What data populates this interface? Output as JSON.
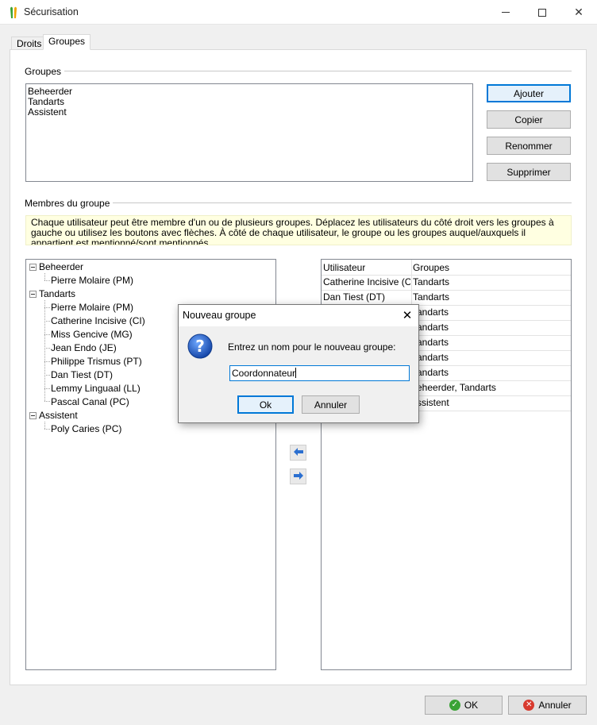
{
  "window": {
    "title": "Sécurisation",
    "icons": {
      "app": "app-logo-icon",
      "minimize": "minimize-icon",
      "maximize": "maximize-icon",
      "close": "close-icon"
    }
  },
  "tabs": [
    {
      "label": "Droits"
    },
    {
      "label": "Groupes"
    }
  ],
  "groups_section": {
    "label": "Groupes",
    "items": [
      "Beheerder",
      "Tandarts",
      "Assistent"
    ],
    "buttons": {
      "add": "Ajouter",
      "copy": "Copier",
      "rename": "Renommer",
      "delete": "Supprimer"
    }
  },
  "members_section": {
    "label": "Membres du groupe",
    "info_text": "Chaque utilisateur peut être membre d'un ou de plusieurs groupes. Déplacez les utilisateurs du côté droit vers les groupes à gauche ou utilisez les boutons avec flèches. À côté de chaque utilisateur, le groupe ou les groupes auquel/auxquels il appartient est mentionné/sont mentionnés.",
    "tree": [
      {
        "group": "Beheerder",
        "members": [
          "Pierre Molaire (PM)"
        ]
      },
      {
        "group": "Tandarts",
        "members": [
          "Pierre Molaire (PM)",
          "Catherine Incisive (CI)",
          "Miss Gencive (MG)",
          "Jean Endo (JE)",
          "Philippe Trismus (PT)",
          "Dan Tiest (DT)",
          "Lemmy Linguaal (LL)",
          "Pascal Canal (PC)"
        ]
      },
      {
        "group": "Assistent",
        "members": [
          "Poly Caries (PC)"
        ]
      }
    ],
    "users_grid": {
      "headers": [
        "Utilisateur",
        "Groupes"
      ],
      "rows": [
        {
          "user": "Catherine Incisive (CI)",
          "groups": "Tandarts"
        },
        {
          "user": "Dan Tiest (DT)",
          "groups": "Tandarts"
        },
        {
          "user": "",
          "groups": "andarts"
        },
        {
          "user": "",
          "groups": "andarts"
        },
        {
          "user": "",
          "groups": "andarts"
        },
        {
          "user": "",
          "groups": "andarts"
        },
        {
          "user": "",
          "groups": "andarts"
        },
        {
          "user": "",
          "groups": "eheerder, Tandarts"
        },
        {
          "user": "",
          "groups": "ssistent"
        }
      ]
    },
    "arrow_icons": [
      "arrow-left-icon",
      "arrow-right-icon"
    ]
  },
  "dialog": {
    "title": "Nouveau groupe",
    "prompt": "Entrez un nom pour le nouveau groupe:",
    "input_value": "Coordonnateur",
    "ok_label": "Ok",
    "cancel_label": "Annuler",
    "icon": "question-icon"
  },
  "footer": {
    "ok_label": "OK",
    "cancel_label": "Annuler",
    "ok_icon": "check-circle-icon",
    "cancel_icon": "cancel-circle-icon"
  },
  "colors": {
    "accent": "#0078d7",
    "info_background": "#ffffe1",
    "ok_green": "#3aa335",
    "cancel_red": "#d83a2e",
    "arrow_blue": "#2b6fd0"
  }
}
